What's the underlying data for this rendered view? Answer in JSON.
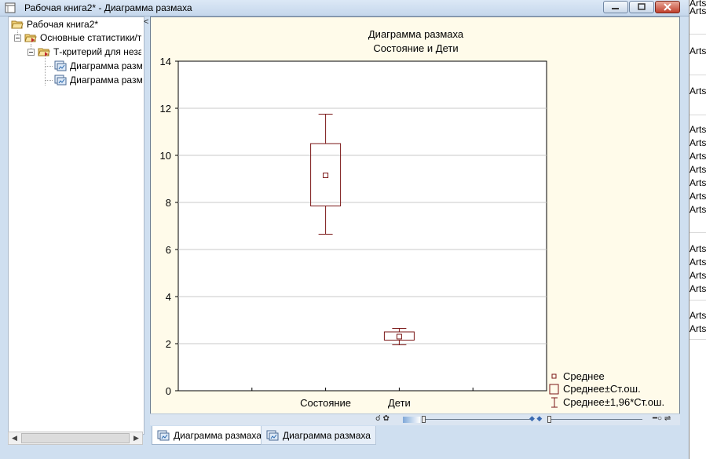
{
  "window": {
    "title": "Рабочая книга2* - Диаграмма размаха"
  },
  "tree": {
    "items": [
      {
        "label": "Рабочая книга2*",
        "icon": "workbook-folder-icon"
      },
      {
        "label": "Основные статистики/т",
        "icon": "folder-icon"
      },
      {
        "label": "Т-критерий для неза",
        "icon": "folder-icon"
      },
      {
        "label": "Диаграмма разм",
        "icon": "graph-icon"
      },
      {
        "label": "Диаграмма разм",
        "icon": "graph-icon"
      }
    ],
    "collapse_glyph": "<"
  },
  "chart_data": {
    "type": "box",
    "title": "Диаграмма размаха",
    "subtitle": "Состояние  и  Дети",
    "categories": [
      "Состояние",
      "Дети"
    ],
    "series": [
      {
        "mean": [
          9.15,
          2.3
        ],
        "se_low": [
          7.85,
          2.15
        ],
        "se_high": [
          10.5,
          2.5
        ],
        "ci_low": [
          6.65,
          1.95
        ],
        "ci_high": [
          11.75,
          2.65
        ]
      }
    ],
    "y_ticks": [
      "0",
      "2",
      "4",
      "6",
      "8",
      "10",
      "12",
      "14"
    ],
    "ylim": [
      0,
      14
    ],
    "grid": true,
    "legend_position": "bottom-right",
    "legend": [
      "Среднее",
      "Среднее±Ст.ош.",
      "Среднее±1,96*Ст.ош."
    ],
    "colors": {
      "marks": "#7a1616",
      "grid": "#c8c8c8",
      "frame_bg": "#fffbea"
    }
  },
  "tabs": [
    {
      "label": "Диаграмма размаха",
      "active": true
    },
    {
      "label": "Диаграмма размаха",
      "active": false
    }
  ],
  "background_sheet": {
    "cells": [
      "Arts",
      "Arts",
      "Arts",
      "Arts",
      "Arts",
      "Arts",
      "Arts",
      "Arts",
      "Arts",
      "Arts",
      "Arts",
      "Arts",
      "Arts",
      "Arts",
      "Arts",
      "Arts",
      "Arts"
    ]
  }
}
